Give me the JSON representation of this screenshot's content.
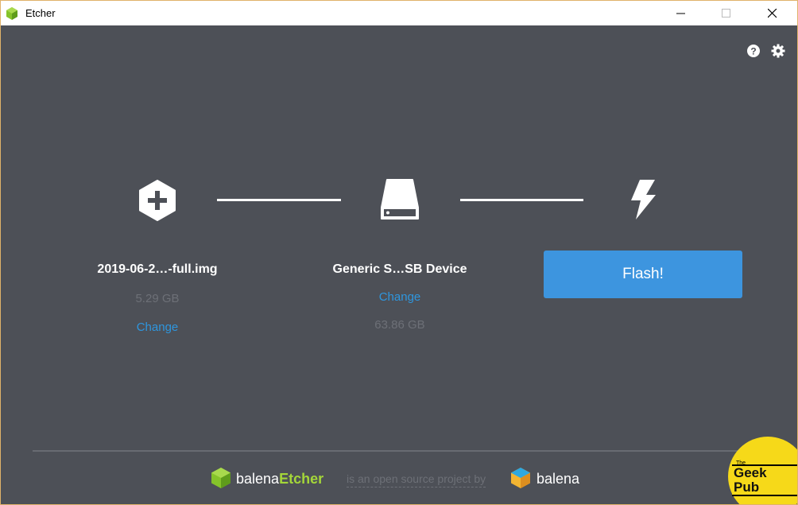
{
  "window": {
    "title": "Etcher"
  },
  "titlebar": {
    "minimize_icon": "minimize-icon",
    "maximize_icon": "maximize-icon",
    "close_icon": "close-icon"
  },
  "toolbar": {
    "help_icon": "help-icon",
    "settings_icon": "gear-icon"
  },
  "steps": {
    "image": {
      "icon": "plus-hexagon-icon",
      "title": "2019-06-2…-full.img",
      "size": "5.29 GB",
      "change_label": "Change"
    },
    "drive": {
      "icon": "drive-icon",
      "title": "Generic S…SB Device",
      "change_label": "Change",
      "size": "63.86 GB"
    },
    "flash": {
      "icon": "lightning-icon",
      "button_label": "Flash!"
    }
  },
  "footer": {
    "brand_prefix": "balena",
    "brand_product": "Etcher",
    "text": "is an open source project by",
    "company": "balena"
  },
  "watermark": {
    "small": "The",
    "text": "Geek Pub"
  },
  "colors": {
    "background": "#4d5057",
    "accent": "#3d95df",
    "link": "#2e96de",
    "etcher_green": "#a4d639",
    "muted": "#6d7077"
  }
}
